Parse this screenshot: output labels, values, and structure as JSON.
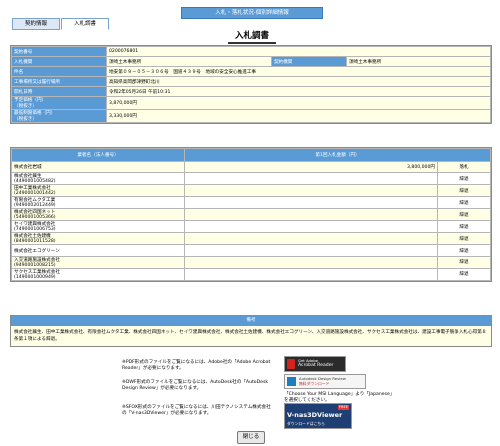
{
  "header": {
    "breadcrumb": "入札・落札状況‐個別詳細情報"
  },
  "tabs": [
    {
      "label": "契約情報"
    },
    {
      "label": "入札調書"
    }
  ],
  "page_title": "入札調書",
  "details": {
    "contract_number": {
      "label": "契約番号",
      "value": "0200076801"
    },
    "office": {
      "label": "入札機関",
      "value": "須崎土木事務所",
      "label2": "契約機関",
      "value2": "須崎土木事務所"
    },
    "project_name": {
      "label": "件名",
      "value": "地安第０９－０５－３０６号　国道４３９号　地域の安全安心推進工事"
    },
    "location": {
      "label": "工事場所又は履行場所",
      "value": "高知県高岡郡津野町北川"
    },
    "open_date": {
      "label": "開札日時",
      "value": "令和2年05月26日 午前10:31"
    },
    "planned_price": {
      "label": "予定価格（円）",
      "sublabel": "（税抜き）",
      "value": "3,870,000円"
    },
    "min_price": {
      "label": "最低制限価格（円）",
      "sublabel": "（税抜き）",
      "value": "3,330,000円"
    }
  },
  "bids": {
    "col_name": "業者名（法人番号）",
    "col_amount": "第1回入札金額（円）",
    "rows": [
      {
        "name": "株式会社岩城",
        "amount": "3,800,000円",
        "result": "落札"
      },
      {
        "name": "株式会社繭生",
        "id": "(4490001005482)",
        "result": "辞退"
      },
      {
        "name": "田中工業株式会社",
        "id": "(2490001001442)",
        "result": "辞退"
      },
      {
        "name": "有限会社ムクタ工業",
        "id": "(9490002012449)",
        "result": "辞退"
      },
      {
        "name": "株式会社四国ネット",
        "id": "(5490001005366)",
        "result": "辞退"
      },
      {
        "name": "セイワ建興株式会社",
        "id": "(7490001006753)",
        "result": "辞退"
      },
      {
        "name": "株式会社土佐建機",
        "id": "(8490001011528)",
        "result": "辞退"
      },
      {
        "name": "株式会社エコグリーン",
        "result": "辞退"
      },
      {
        "name": "入交道路施設株式会社",
        "id": "(9490001008215)",
        "result": "辞退"
      },
      {
        "name": "サクセス工業株式会社",
        "id": "(1490001000949)",
        "result": "辞退"
      }
    ]
  },
  "notes": {
    "heading": "備考",
    "text": "株式会社繭生、田中工業株式会社、有限会社ムクタ工業、株式会社四国ネット、セイワ建興株式会社、株式会社土佐建機、株式会社エコグリーン、入交道路施設株式会社、サクセス工業株式会社は、建設工事電子競争入札心得第８条第１項による辞退。"
  },
  "info": {
    "pdf": "※PDF形式のファイルをご覧になるには、Adobe社の「Adobe Acrobat Reader」が必要になります。",
    "dwf": "※DWF形式のファイルをご覧になるには、AutoDesk社の「AutoDesk Design Review」が必要になります。",
    "dwf_note": "「Choose Your MSI Language」より「Japanese」を選択してください。",
    "sfx": "※SFOX形式のファイルをご覧になるには、川田テクノシステム株式会社の「V-nas3DViewer」が必要になります。"
  },
  "badges": {
    "adobe": {
      "line1": "Get Adobe",
      "line2": "Acrobat Reader"
    },
    "autodesk": {
      "line1": "Autodesk Design Review",
      "line2": "無料ダウンロード"
    },
    "vnas": {
      "line1": "V-nas3DViewer",
      "tag": "FREE",
      "line2": "ダウンロードはこちら"
    }
  },
  "close_label": "閉じる"
}
